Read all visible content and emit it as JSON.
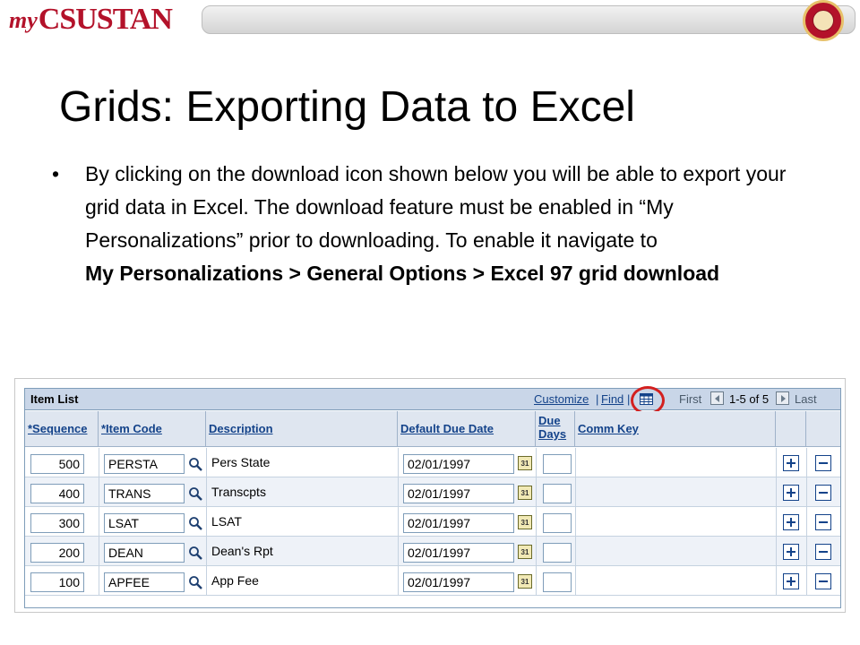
{
  "header": {
    "logo_my": "my",
    "logo_rest": "CSUSTAN",
    "seal": "university-seal"
  },
  "slide": {
    "title": "Grids: Exporting Data to Excel",
    "bullet_symbol": "•",
    "bullet_text": "By clicking on the download icon shown below you will be able to export your grid data in Excel.  The download feature must be enabled in  “My Personalizations”  prior to downloading.  To enable it navigate to",
    "bullet_path": "My Personalizations > General Options > Excel 97 grid download"
  },
  "grid": {
    "title": "Item List",
    "customize": "Customize",
    "separator": "|",
    "find": "Find",
    "first": "First",
    "range": "1-5 of 5",
    "last": "Last",
    "columns": {
      "sequence": "*Sequence",
      "item_code": "*Item Code",
      "description": "Description",
      "default_due_date": "Default Due Date",
      "due_days_1": "Due",
      "due_days_2": "Days",
      "comm_key": "Comm Key"
    },
    "rows": [
      {
        "sequence": "500",
        "item_code": "PERSTA",
        "description": "Pers State",
        "due_date": "02/01/1997",
        "due_days": "",
        "comm_key": ""
      },
      {
        "sequence": "400",
        "item_code": "TRANS",
        "description": "Transcpts",
        "due_date": "02/01/1997",
        "due_days": "",
        "comm_key": ""
      },
      {
        "sequence": "300",
        "item_code": "LSAT",
        "description": "LSAT",
        "due_date": "02/01/1997",
        "due_days": "",
        "comm_key": ""
      },
      {
        "sequence": "200",
        "item_code": "DEAN",
        "description": "Dean's Rpt",
        "due_date": "02/01/1997",
        "due_days": "",
        "comm_key": ""
      },
      {
        "sequence": "100",
        "item_code": "APFEE",
        "description": "App Fee",
        "due_date": "02/01/1997",
        "due_days": "",
        "comm_key": ""
      }
    ],
    "calendar_label": "31",
    "icons": {
      "download": "download-grid-icon",
      "lookup": "magnifier-icon",
      "calendar": "calendar-icon",
      "add": "plus-icon",
      "remove": "minus-icon"
    },
    "colors": {
      "header_bg": "#c9d6e8",
      "link": "#14438a",
      "highlight": "#d3201f"
    }
  }
}
